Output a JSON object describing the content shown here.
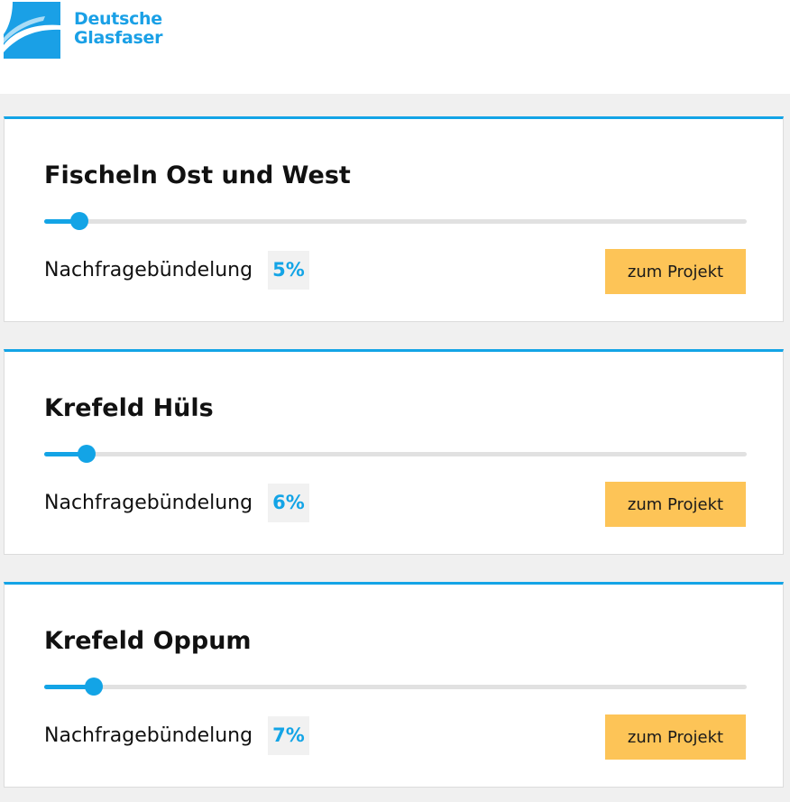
{
  "brand": {
    "line1": "Deutsche",
    "line2": "Glasfaser",
    "color": "#1aa0e6"
  },
  "projects": [
    {
      "title": "Fischeln Ost und West",
      "metric_label": "Nachfragebündelung",
      "percent_text": "5%",
      "progress": 0.05,
      "button_label": "zum Projekt"
    },
    {
      "title": "Krefeld Hüls",
      "metric_label": "Nachfragebündelung",
      "percent_text": "6%",
      "progress": 0.06,
      "button_label": "zum Projekt"
    },
    {
      "title": "Krefeld Oppum",
      "metric_label": "Nachfragebündelung",
      "percent_text": "7%",
      "progress": 0.07,
      "button_label": "zum Projekt"
    }
  ],
  "colors": {
    "accent": "#13a4e6",
    "button": "#fdc457",
    "track": "#e1e1e1"
  }
}
